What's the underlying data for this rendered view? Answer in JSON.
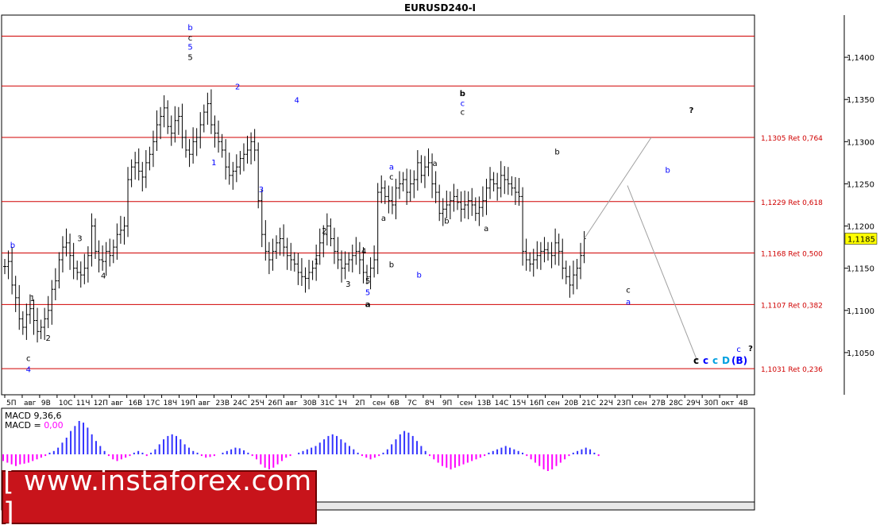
{
  "title": "EURUSD240-I",
  "price_box": "1,1185",
  "macd": {
    "line1": "MACD 9,36,6",
    "line2_prefix": "MACD = ",
    "line2_value": "0,00"
  },
  "promo": "[ www.instaforex.com ]",
  "colors": {
    "fib_line": "#d00000",
    "price_box_bg": "#ffff00",
    "wave_blue": "#0000ff",
    "wave_black": "#000000",
    "wave_cyan": "#00a0e0",
    "macd_pos": "#3333ff",
    "macd_neg": "#ff00ff",
    "promo_bg": "#c8141b"
  },
  "chart_data": {
    "type": "ohlc-bar",
    "ylim": [
      1.1,
      1.145
    ],
    "y_ticks": [
      "1,1400",
      "1,1350",
      "1,1300",
      "1,1250",
      "1,1200",
      "1,1150",
      "1,1100",
      "1,1050"
    ],
    "y_tick_values": [
      1.14,
      1.135,
      1.13,
      1.125,
      1.12,
      1.115,
      1.11,
      1.105
    ],
    "x_ticks": [
      "5П",
      "авг",
      "9В",
      "10С",
      "11Ч",
      "12П",
      "авг",
      "16В",
      "17С",
      "18Ч",
      "19П",
      "авг",
      "23В",
      "24С",
      "25Ч",
      "26П",
      "авг",
      "30В",
      "31С",
      "1Ч",
      "2П",
      "сен",
      "6В",
      "7С",
      "8Ч",
      "9П",
      "сен",
      "13В",
      "14С",
      "15Ч",
      "16П",
      "сен",
      "20В",
      "21С",
      "22Ч",
      "23П",
      "сен",
      "27В",
      "28С",
      "29Ч",
      "30П",
      "окт",
      "4В"
    ],
    "fib_levels": [
      {
        "value": 1.1425,
        "label": ""
      },
      {
        "value": 1.1366,
        "label": ""
      },
      {
        "value": 1.1305,
        "label": "1,1305 Ret 0,764"
      },
      {
        "value": 1.1229,
        "label": "1,1229 Ret 0,618"
      },
      {
        "value": 1.1168,
        "label": "1,1168 Ret 0,500"
      },
      {
        "value": 1.1107,
        "label": "1,1107 Ret 0,382"
      },
      {
        "value": 1.1031,
        "label": "1,1031 Ret 0,236"
      }
    ],
    "price_path": [
      1.1152,
      1.1158,
      1.113,
      1.1115,
      1.109,
      1.108,
      1.1095,
      1.1102,
      1.1088,
      1.1075,
      1.108,
      1.109,
      1.11,
      1.1125,
      1.1135,
      1.116,
      1.1175,
      1.118,
      1.1165,
      1.115,
      1.1145,
      1.1142,
      1.115,
      1.1165,
      1.12,
      1.117,
      1.116,
      1.1158,
      1.117,
      1.1165,
      1.1175,
      1.119,
      1.1195,
      1.12,
      1.1255,
      1.127,
      1.1275,
      1.1265,
      1.1258,
      1.1275,
      1.1285,
      1.13,
      1.132,
      1.133,
      1.134,
      1.1318,
      1.131,
      1.1325,
      1.133,
      1.1305,
      1.129,
      1.1285,
      1.13,
      1.1305,
      1.132,
      1.1335,
      1.1345,
      1.132,
      1.131,
      1.13,
      1.129,
      1.127,
      1.126,
      1.1265,
      1.127,
      1.128,
      1.1285,
      1.129,
      1.13,
      1.129,
      1.123,
      1.119,
      1.117,
      1.116,
      1.117,
      1.118,
      1.1185,
      1.1175,
      1.1165,
      1.116,
      1.1155,
      1.1145,
      1.114,
      1.1138,
      1.1145,
      1.115,
      1.1165,
      1.118,
      1.119,
      1.12,
      1.1185,
      1.117,
      1.116,
      1.115,
      1.1155,
      1.116,
      1.1165,
      1.117,
      1.116,
      1.1145,
      1.114,
      1.115,
      1.116,
      1.124,
      1.1245,
      1.1235,
      1.123,
      1.1225,
      1.1245,
      1.125,
      1.1255,
      1.124,
      1.125,
      1.1255,
      1.1275,
      1.126,
      1.127,
      1.1275,
      1.125,
      1.124,
      1.1215,
      1.122,
      1.1225,
      1.123,
      1.1235,
      1.1228,
      1.122,
      1.1225,
      1.123,
      1.1225,
      1.1215,
      1.1222,
      1.123,
      1.1245,
      1.1255,
      1.125,
      1.1245,
      1.126,
      1.1255,
      1.125,
      1.1245,
      1.124,
      1.1235,
      1.117,
      1.116,
      1.1155,
      1.116,
      1.1165,
      1.117,
      1.1172,
      1.1168,
      1.1165,
      1.118,
      1.117,
      1.115,
      1.114,
      1.113,
      1.1142,
      1.115,
      1.1165,
      1.1185
    ],
    "projection": [
      [
        1.1185,
        1.1305
      ],
      [
        1.1248,
        1.104
      ]
    ],
    "wave_labels": [
      {
        "t": "b",
        "c": "blue",
        "i": 0.02,
        "y": 1.1174
      },
      {
        "t": "1",
        "c": "black",
        "i": 0.07,
        "y": 1.1111
      },
      {
        "t": "c",
        "c": "black",
        "i": 0.06,
        "y": 1.104
      },
      {
        "t": "4",
        "c": "blue",
        "i": 0.06,
        "y": 1.1027
      },
      {
        "t": "2",
        "c": "black",
        "i": 0.11,
        "y": 1.1064
      },
      {
        "t": "3",
        "c": "black",
        "i": 0.19,
        "y": 1.1182
      },
      {
        "t": "4",
        "c": "black",
        "i": 0.25,
        "y": 1.1138
      },
      {
        "t": "b",
        "c": "blue",
        "i": 0.47,
        "y": 1.1432
      },
      {
        "t": "c",
        "c": "black",
        "i": 0.47,
        "y": 1.142
      },
      {
        "t": "5",
        "c": "blue",
        "i": 0.47,
        "y": 1.1409
      },
      {
        "t": "5",
        "c": "black",
        "i": 0.47,
        "y": 1.1397
      },
      {
        "t": "2",
        "c": "blue",
        "i": 0.59,
        "y": 1.1362
      },
      {
        "t": "1",
        "c": "blue",
        "i": 0.53,
        "y": 1.1272
      },
      {
        "t": "4",
        "c": "blue",
        "i": 0.74,
        "y": 1.1346
      },
      {
        "t": "3",
        "c": "blue",
        "i": 0.65,
        "y": 1.124
      },
      {
        "t": "1",
        "c": "black",
        "i": 0.79,
        "y": 1.1155
      },
      {
        "t": "2",
        "c": "black",
        "i": 0.81,
        "y": 1.1191
      },
      {
        "t": "3",
        "c": "black",
        "i": 0.87,
        "y": 1.1128
      },
      {
        "t": "4",
        "c": "black",
        "i": 0.91,
        "y": 1.1167
      },
      {
        "t": "5",
        "c": "black",
        "i": 0.92,
        "y": 1.1132
      },
      {
        "t": "5",
        "c": "blue",
        "i": 0.92,
        "y": 1.1118
      },
      {
        "t": "a",
        "c": "black",
        "i": 0.92,
        "y": 1.1104
      },
      {
        "t": "a",
        "c": "black",
        "i": 0.96,
        "y": 1.1206
      },
      {
        "t": "a",
        "c": "blue",
        "i": 0.98,
        "y": 1.1267
      },
      {
        "t": "c",
        "c": "black",
        "i": 0.98,
        "y": 1.1255
      },
      {
        "t": "b",
        "c": "black",
        "i": 0.98,
        "y": 1.1151
      },
      {
        "t": "b",
        "c": "blue",
        "i": 1.05,
        "y": 1.1139
      },
      {
        "t": "a",
        "c": "black",
        "i": 1.09,
        "y": 1.1271
      },
      {
        "t": "b",
        "c": "black",
        "i": 1.12,
        "y": 1.1203
      },
      {
        "t": "b",
        "c": "black",
        "i": 1.16,
        "y": 1.1354
      },
      {
        "t": "c",
        "c": "blue",
        "i": 1.16,
        "y": 1.1342
      },
      {
        "t": "c",
        "c": "black",
        "i": 1.16,
        "y": 1.1332
      },
      {
        "t": "a",
        "c": "black",
        "i": 1.22,
        "y": 1.1194
      },
      {
        "t": "b",
        "c": "black",
        "i": 1.4,
        "y": 1.1285
      },
      {
        "t": "c",
        "c": "black",
        "i": 1.58,
        "y": 1.1121
      },
      {
        "t": "a",
        "c": "blue",
        "i": 1.58,
        "y": 1.1107
      },
      {
        "t": "b",
        "c": "blue",
        "i": 1.68,
        "y": 1.1263
      },
      {
        "t": "?",
        "c": "black",
        "i": 1.74,
        "y": 1.1334
      },
      {
        "t": "c",
        "c": "blue",
        "i": 1.86,
        "y": 1.1051
      },
      {
        "t": "?",
        "c": "black",
        "i": 1.89,
        "y": 1.1052
      }
    ],
    "wave_group_bottom": [
      {
        "t": "c",
        "c": "black"
      },
      {
        "t": "c",
        "c": "blue"
      },
      {
        "t": "c",
        "c": "cyan"
      },
      {
        "t": "D",
        "c": "cyan"
      },
      {
        "t": "(B)",
        "c": "blue"
      }
    ],
    "macd_values": [
      -0.2,
      -0.25,
      -0.3,
      -0.35,
      -0.3,
      -0.28,
      -0.25,
      -0.2,
      -0.15,
      -0.1,
      -0.05,
      0.05,
      0.1,
      0.2,
      0.35,
      0.5,
      0.7,
      0.85,
      1.0,
      0.95,
      0.8,
      0.6,
      0.4,
      0.25,
      0.1,
      -0.05,
      -0.15,
      -0.2,
      -0.15,
      -0.1,
      -0.05,
      0.05,
      0.1,
      0.05,
      -0.05,
      0.05,
      0.15,
      0.3,
      0.45,
      0.55,
      0.6,
      0.55,
      0.45,
      0.3,
      0.2,
      0.1,
      0.05,
      -0.05,
      -0.1,
      -0.08,
      -0.05,
      0.0,
      0.05,
      0.1,
      0.15,
      0.2,
      0.18,
      0.12,
      0.05,
      -0.05,
      -0.15,
      -0.3,
      -0.4,
      -0.45,
      -0.4,
      -0.3,
      -0.2,
      -0.1,
      -0.05,
      0.0,
      0.05,
      0.1,
      0.15,
      0.2,
      0.25,
      0.35,
      0.45,
      0.55,
      0.6,
      0.55,
      0.45,
      0.35,
      0.25,
      0.15,
      0.05,
      -0.05,
      -0.1,
      -0.15,
      -0.1,
      -0.05,
      0.05,
      0.15,
      0.3,
      0.45,
      0.6,
      0.7,
      0.65,
      0.55,
      0.4,
      0.25,
      0.1,
      -0.05,
      -0.15,
      -0.25,
      -0.35,
      -0.4,
      -0.45,
      -0.4,
      -0.35,
      -0.3,
      -0.25,
      -0.2,
      -0.15,
      -0.1,
      -0.05,
      0.05,
      0.1,
      0.15,
      0.2,
      0.25,
      0.2,
      0.15,
      0.1,
      0.05,
      -0.05,
      -0.15,
      -0.25,
      -0.35,
      -0.45,
      -0.5,
      -0.45,
      -0.35,
      -0.25,
      -0.15,
      -0.05,
      0.05,
      0.1,
      0.15,
      0.2,
      0.15,
      0.05,
      -0.05
    ]
  }
}
